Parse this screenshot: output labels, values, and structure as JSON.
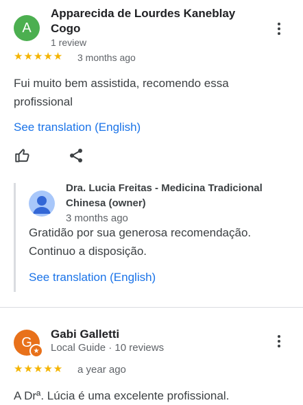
{
  "review1": {
    "avatar_letter": "A",
    "avatar_color": "#4caf50",
    "name_line1": "Apparecida de Lourdes Kaneblay",
    "name_line2": "Cogo",
    "review_count": "1 review",
    "stars": "★★★★★",
    "time": "3 months ago",
    "text_line1": "Fui muito bem assistida, recomendo essa",
    "text_line2": "profissional",
    "translate_link": "See translation (English)",
    "actions": [
      "thumbs-up-icon",
      "share-icon"
    ]
  },
  "owner_reply": {
    "avatar_color": "#a8c7fa",
    "name_line1": "Dra. Lucia Freitas - Medicina Tradicional",
    "name_line2": "Chinesa (owner)",
    "time": "3 months ago",
    "text_line1": "Gratidão por sua generosa recomendação.",
    "text_line2": "Continuo a disposição.",
    "translate_link": "See translation (English)"
  },
  "review2": {
    "avatar_letter": "G",
    "avatar_color": "#e8711a",
    "name": "Gabi Galletti",
    "meta": "Local Guide · 10 reviews",
    "stars": "★★★★★",
    "time": "a year ago",
    "text_line1": "A Drª. Lúcia é uma excelente profissional."
  },
  "colors": {
    "star": "#f4b400",
    "link": "#1a73e8"
  }
}
